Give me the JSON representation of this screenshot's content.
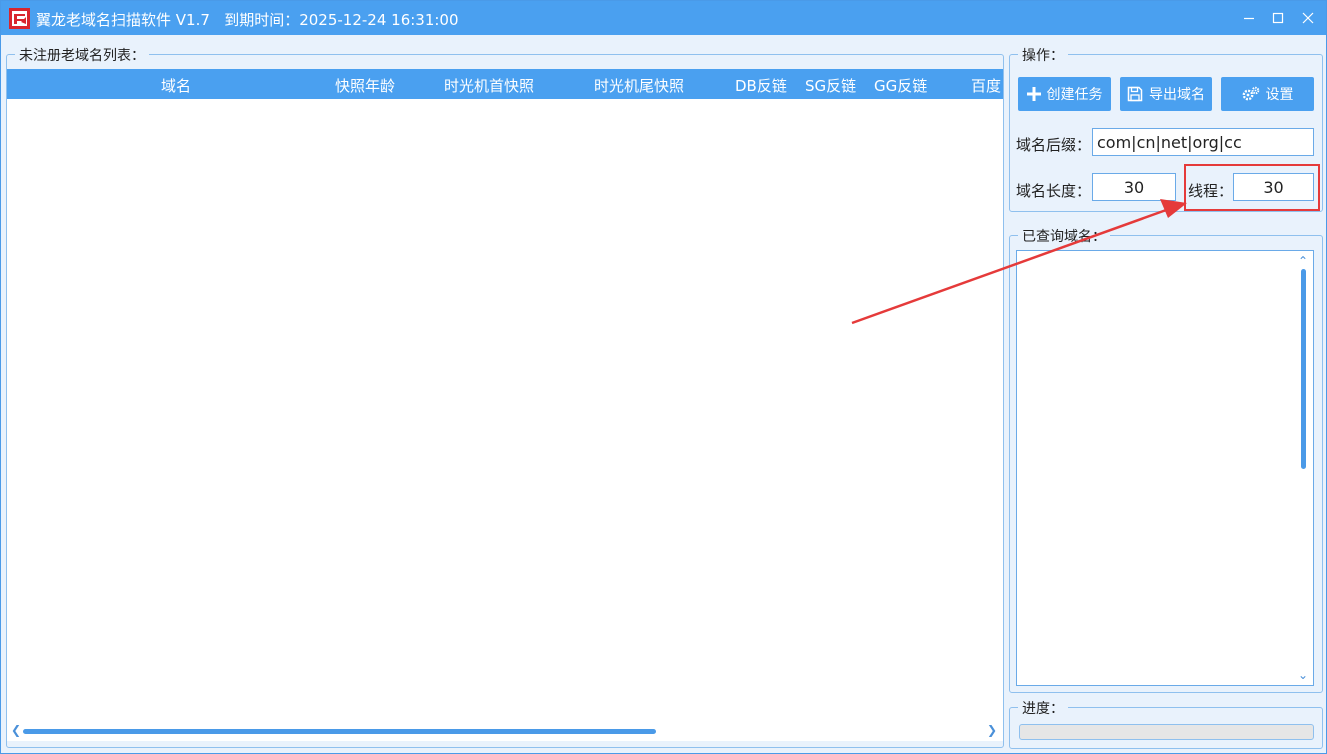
{
  "window": {
    "title": "翼龙老域名扫描软件 V1.7",
    "expiry": "到期时间：2025-12-24 16:31:00"
  },
  "list_group": {
    "title": "未注册老域名列表："
  },
  "table": {
    "columns": [
      "域名",
      "快照年龄",
      "时光机首快照",
      "时光机尾快照",
      "DB反链",
      "SG反链",
      "GG反链",
      "百度"
    ]
  },
  "ops": {
    "title": "操作：",
    "create_task": "创建任务",
    "export": "导出域名",
    "settings": "设置",
    "suffix_label": "域名后缀：",
    "suffix_value": "com|cn|net|org|cc",
    "length_label": "域名长度：",
    "length_value": "30",
    "threads_label": "线程：",
    "threads_value": "30"
  },
  "queried_group": {
    "title": "已查询域名："
  },
  "progress_group": {
    "title": "进度：",
    "value": 0
  },
  "colors": {
    "accent": "#4aa0f0",
    "highlight": "#e53a3a",
    "background": "#e9f2fc"
  }
}
